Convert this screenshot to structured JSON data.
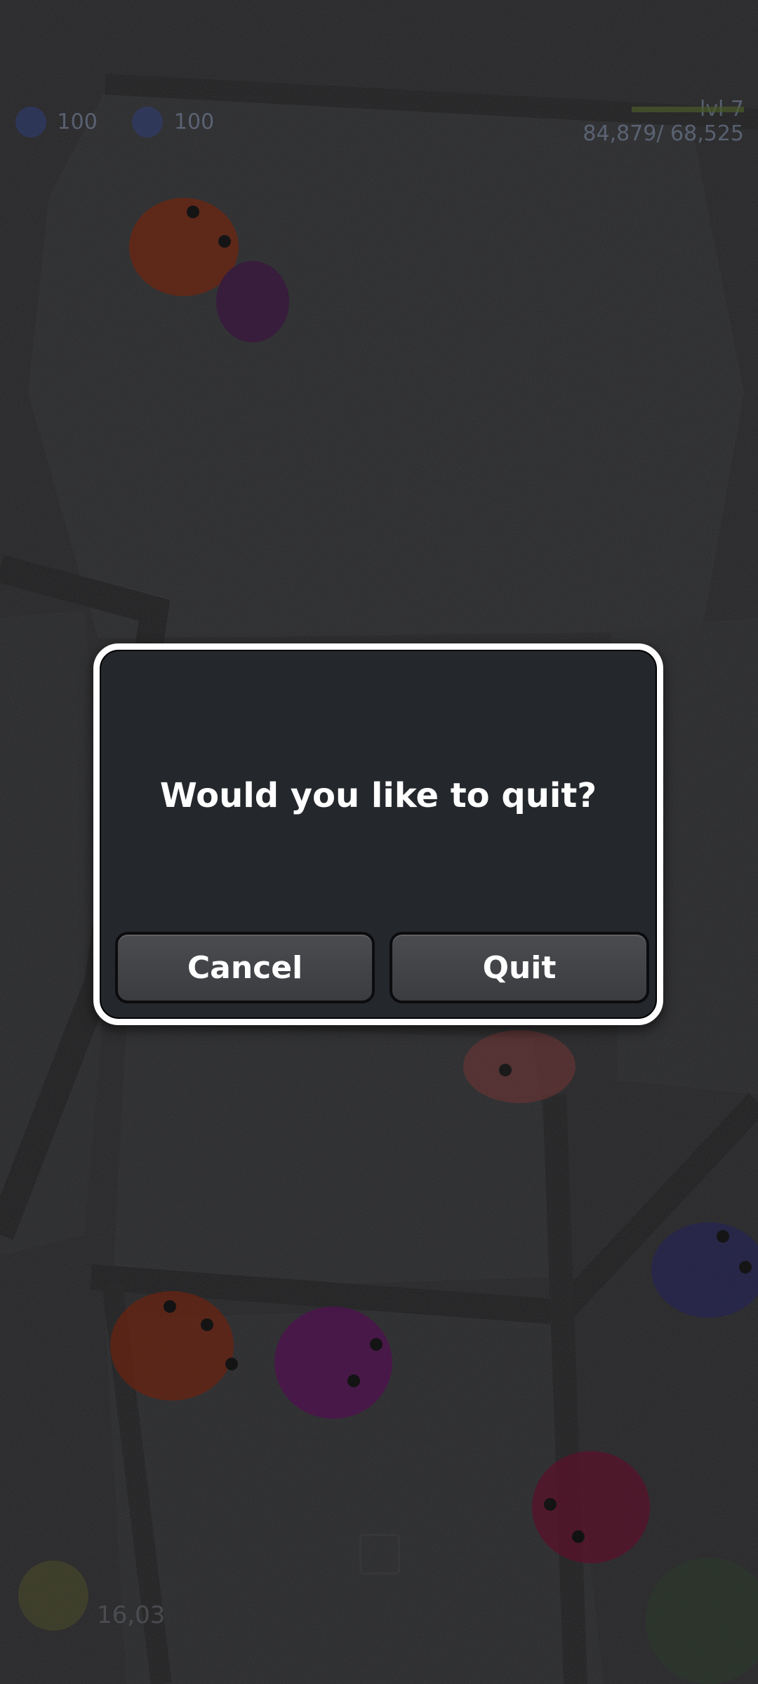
{
  "dialog": {
    "message": "Would you like to quit?",
    "cancel_label": "Cancel",
    "quit_label": "Quit"
  },
  "hud": {
    "resource_a": "100",
    "resource_b": "100",
    "level": "lvl 7",
    "xp_progress": "84,879/ 68,525",
    "bottom_value": "16,03"
  },
  "colors": {
    "dialog_bg": "#24272c",
    "dialog_border": "#ffffff",
    "button_bg": "#3b3c40",
    "overlay_dim": "#000000"
  }
}
